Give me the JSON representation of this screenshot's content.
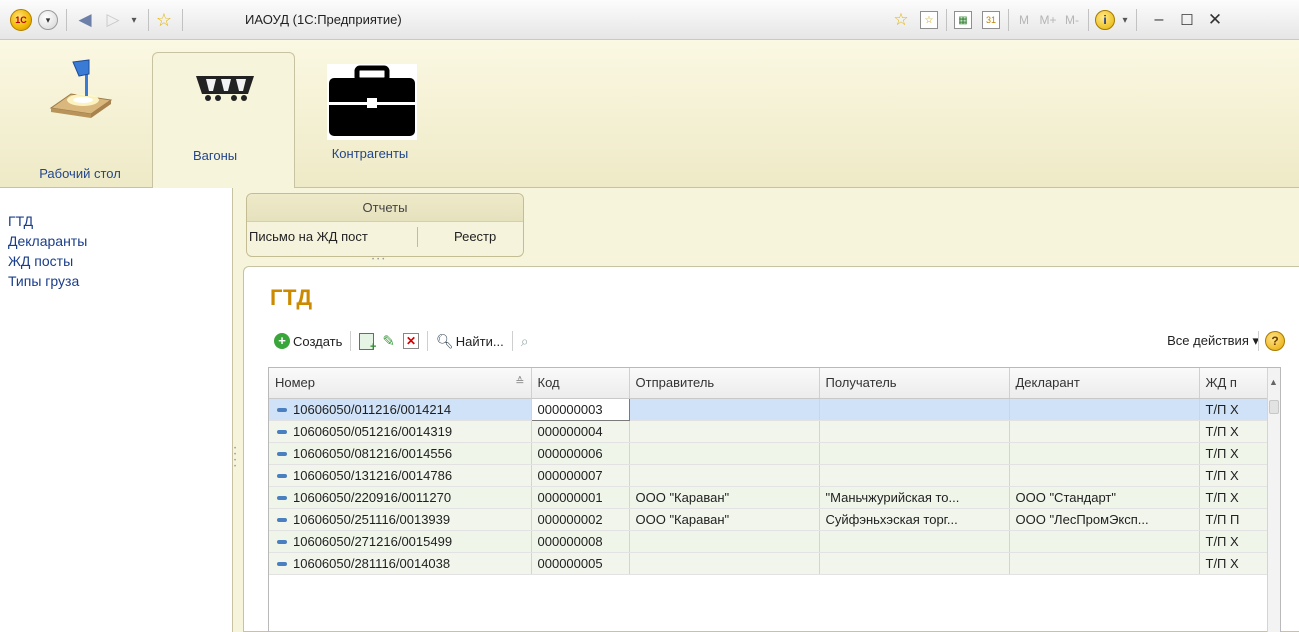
{
  "window": {
    "title": "ИАОУД (1С:Предприятие)",
    "logo_text": "1С",
    "mem_buttons": [
      "M",
      "M+",
      "M-"
    ],
    "info_label": "i"
  },
  "sections": [
    {
      "label": "Рабочий стол",
      "icon": "desk-lamp-icon"
    },
    {
      "label": "Вагоны",
      "icon": "railcar-icon"
    },
    {
      "label": "Контрагенты",
      "icon": "briefcase-icon"
    }
  ],
  "nav": {
    "items": [
      "ГТД",
      "Декларанты",
      "ЖД посты",
      "Типы груза"
    ]
  },
  "reports": {
    "title": "Отчеты",
    "links": [
      "Письмо на ЖД пост",
      "Реестр"
    ]
  },
  "form": {
    "title": "ГТД",
    "toolbar": {
      "create_label": "Создать",
      "find_label": "Найти...",
      "all_actions_label": "Все действия ▾",
      "help_label": "?"
    },
    "table": {
      "columns": [
        "Номер",
        "Код",
        "Отправитель",
        "Получатель",
        "Декларант",
        "ЖД п"
      ],
      "rows": [
        [
          "10606050/011216/0014214",
          "000000003",
          "",
          "",
          "",
          "Т/П Х"
        ],
        [
          "10606050/051216/0014319",
          "000000004",
          "",
          "",
          "",
          "Т/П Х"
        ],
        [
          "10606050/081216/0014556",
          "000000006",
          "",
          "",
          "",
          "Т/П Х"
        ],
        [
          "10606050/131216/0014786",
          "000000007",
          "",
          "",
          "",
          "Т/П Х"
        ],
        [
          "10606050/220916/0011270",
          "000000001",
          "ООО \"Караван\"",
          "\"Маньчжурийская то...",
          "ООО \"Стандарт\"",
          "Т/П Х"
        ],
        [
          "10606050/251116/0013939",
          "000000002",
          "ООО \"Караван\"",
          "Суйфэньхэская торг...",
          "ООО \"ЛесПромЭксп...",
          "Т/П П"
        ],
        [
          "10606050/271216/0015499",
          "000000008",
          "",
          "",
          "",
          "Т/П Х"
        ],
        [
          "10606050/281116/0014038",
          "000000005",
          "",
          "",
          "",
          "Т/П Х"
        ]
      ]
    }
  },
  "colors": {
    "accent_title": "#cc8a00",
    "link": "#1a3d8a",
    "selection": "#cfe2f7"
  }
}
